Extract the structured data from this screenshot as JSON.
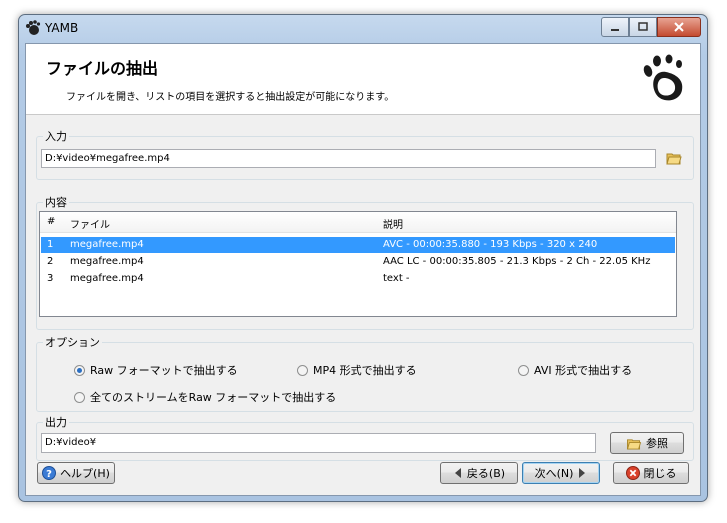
{
  "window": {
    "title": "YAMB"
  },
  "header": {
    "title": "ファイルの抽出",
    "description": "ファイルを開き、リストの項目を選択すると抽出設定が可能になります。"
  },
  "input_group": {
    "label": "入力",
    "path": "D:¥video¥megafree.mp4"
  },
  "contents_group": {
    "label": "内容",
    "columns": [
      "#",
      "ファイル",
      "説明"
    ],
    "rows": [
      {
        "num": "1",
        "file": "megafree.mp4",
        "desc": "AVC - 00:00:35.880 - 193 Kbps - 320 x 240",
        "selected": true
      },
      {
        "num": "2",
        "file": "megafree.mp4",
        "desc": "AAC LC - 00:00:35.805 - 21.3 Kbps - 2 Ch - 22.05 KHz",
        "selected": false
      },
      {
        "num": "3",
        "file": "megafree.mp4",
        "desc": "text -",
        "selected": false
      }
    ]
  },
  "options_group": {
    "label": "オプション",
    "raw": "Raw フォーマットで抽出する",
    "mp4": "MP4 形式で抽出する",
    "avi": "AVI 形式で抽出する",
    "all_raw": "全てのストリームをRaw フォーマットで抽出する",
    "selected": "raw"
  },
  "output_group": {
    "label": "出力",
    "path": "D:¥video¥",
    "browse_label": "参照"
  },
  "buttons": {
    "help": "ヘルプ(H)",
    "back": "戻る(B)",
    "next": "次へ(N)",
    "close": "閉じる"
  },
  "colors": {
    "selection": "#3399ff",
    "titlebar": "#b3cbe6"
  }
}
